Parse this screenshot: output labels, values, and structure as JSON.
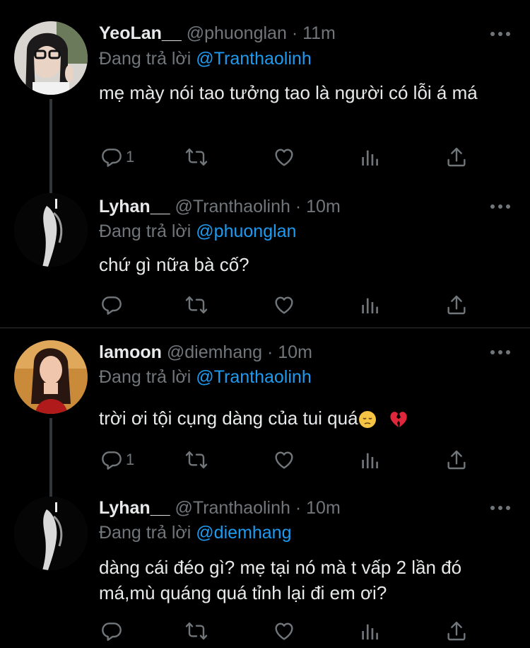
{
  "tweets": [
    {
      "name": "YeoLan__",
      "handle": "@phuonglan",
      "time": "· 11m",
      "reply_prefix": "Đang trả lời",
      "reply_to": "@Tranthaolinh",
      "text": "mẹ mày nói tao tưởng tao là người có lỗi á má",
      "reply_count": "1"
    },
    {
      "name": "Lyhan__",
      "handle": "@Tranthaolinh",
      "time": "· 10m",
      "reply_prefix": "Đang trả lời",
      "reply_to": "@phuonglan",
      "text": "chứ gì nữa bà cố?",
      "reply_count": ""
    },
    {
      "name": "lamoon",
      "handle": "@diemhang",
      "time": "· 10m",
      "reply_prefix": "Đang trả lời",
      "reply_to": "@Tranthaolinh",
      "text": "trời ơi tội cụng dàng của tui quá",
      "reply_count": "1"
    },
    {
      "name": "Lyhan__",
      "handle": "@Tranthaolinh",
      "time": "· 10m",
      "reply_prefix": "Đang trả lời",
      "reply_to": "@diemhang",
      "text": "dàng cái đéo gì? mẹ tại nó mà t vấp 2 lần đó má,mù quáng quá tỉnh lại đi em ơi?",
      "reply_count": ""
    }
  ],
  "colors": {
    "background": "#000000",
    "text": "#e7e9ea",
    "secondary": "#71767b",
    "mention": "#1d9bf0"
  },
  "icons": [
    "reply-icon",
    "retweet-icon",
    "like-icon",
    "analytics-icon",
    "share-icon",
    "more-icon"
  ]
}
